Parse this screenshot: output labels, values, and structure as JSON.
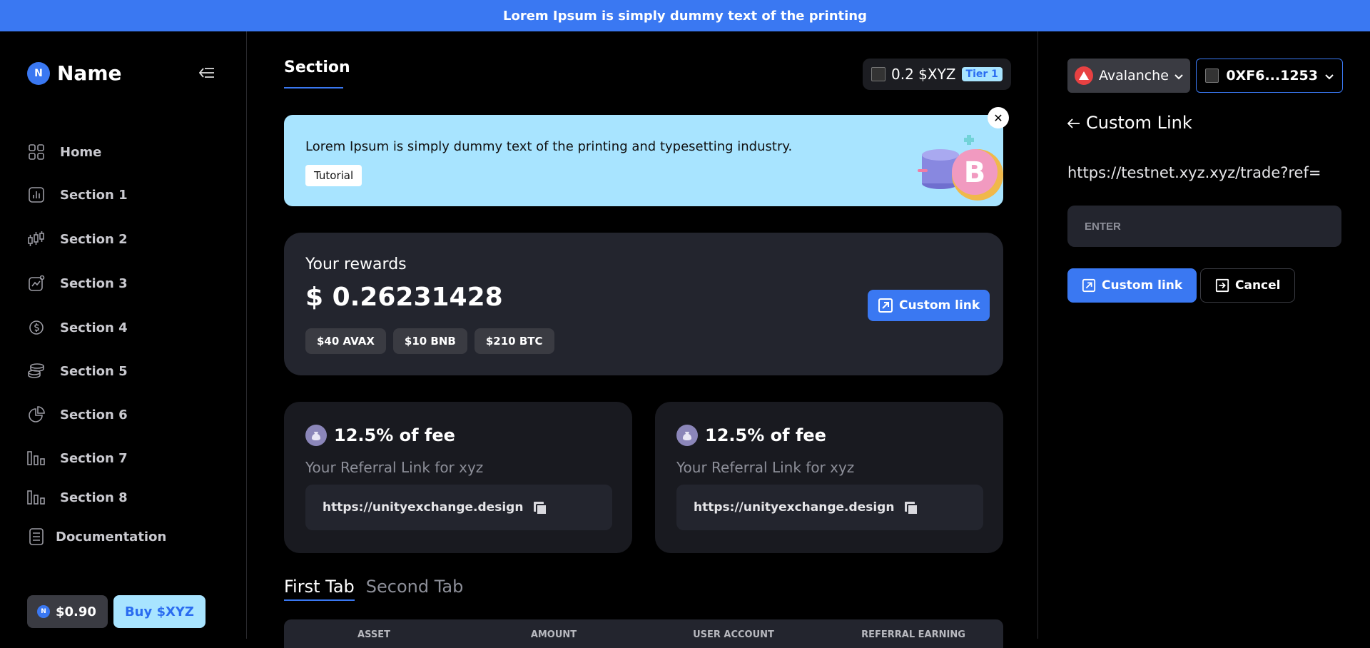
{
  "topbar": {
    "text": "Lorem Ipsum is simply dummy text of the printing"
  },
  "sidebar": {
    "brand_initial": "N",
    "brand_name": "Name",
    "items": [
      {
        "label": "Home",
        "icon": "grid-icon"
      },
      {
        "label": "Section 1",
        "icon": "bar-chart-icon"
      },
      {
        "label": "Section 2",
        "icon": "candlestick-icon"
      },
      {
        "label": "Section 3",
        "icon": "trend-chart-icon"
      },
      {
        "label": "Section 4",
        "icon": "dollar-sync-icon"
      },
      {
        "label": "Section 5",
        "icon": "coins-stack-icon"
      },
      {
        "label": "Section 6",
        "icon": "pie-chart-icon"
      },
      {
        "label": "Section 7",
        "icon": "bars-icon"
      },
      {
        "label": "Section 8",
        "icon": "bars-icon"
      },
      {
        "label": "Documentation",
        "icon": "document-icon"
      }
    ],
    "price_initial": "N",
    "price": "$0.90",
    "buy_label": "Buy $XYZ"
  },
  "main": {
    "title": "Section",
    "token_amount": "0.2 $XYZ",
    "tier": "Tier 1",
    "banner_text": "Lorem Ipsum is simply dummy text of the printing and typesetting industry.",
    "tutorial_label": "Tutorial",
    "rewards_label": "Your rewards",
    "rewards_value": "$ 0.26231428",
    "reward_chips": [
      "$40 AVAX",
      "$10 BNB",
      "$210 BTC"
    ],
    "custom_link_label": "Custom link",
    "ref_cards": [
      {
        "fee": "12.5% of fee",
        "subtitle": "Your Referral Link for xyz",
        "link": "https://unityexchange.design"
      },
      {
        "fee": "12.5% of fee",
        "subtitle": "Your Referral Link for xyz",
        "link": "https://unityexchange.design"
      }
    ],
    "tabs": [
      "First Tab",
      "Second Tab"
    ],
    "table_headers": [
      "ASSET",
      "AMOUNT",
      "USER ACCOUNT",
      "REFERRAL EARNING"
    ]
  },
  "right_panel": {
    "network": "Avalanche",
    "wallet": "0XF6...1253",
    "title": "Custom Link",
    "ref_url": "https://testnet.xyz.xyz/trade?ref=",
    "input_placeholder": "ENTER",
    "custom_link_label": "Custom link",
    "cancel_label": "Cancel"
  },
  "colors": {
    "accent": "#3a78f2",
    "light_blue": "#a8e4ff",
    "card": "#23252e",
    "card_dark": "#191a20"
  }
}
